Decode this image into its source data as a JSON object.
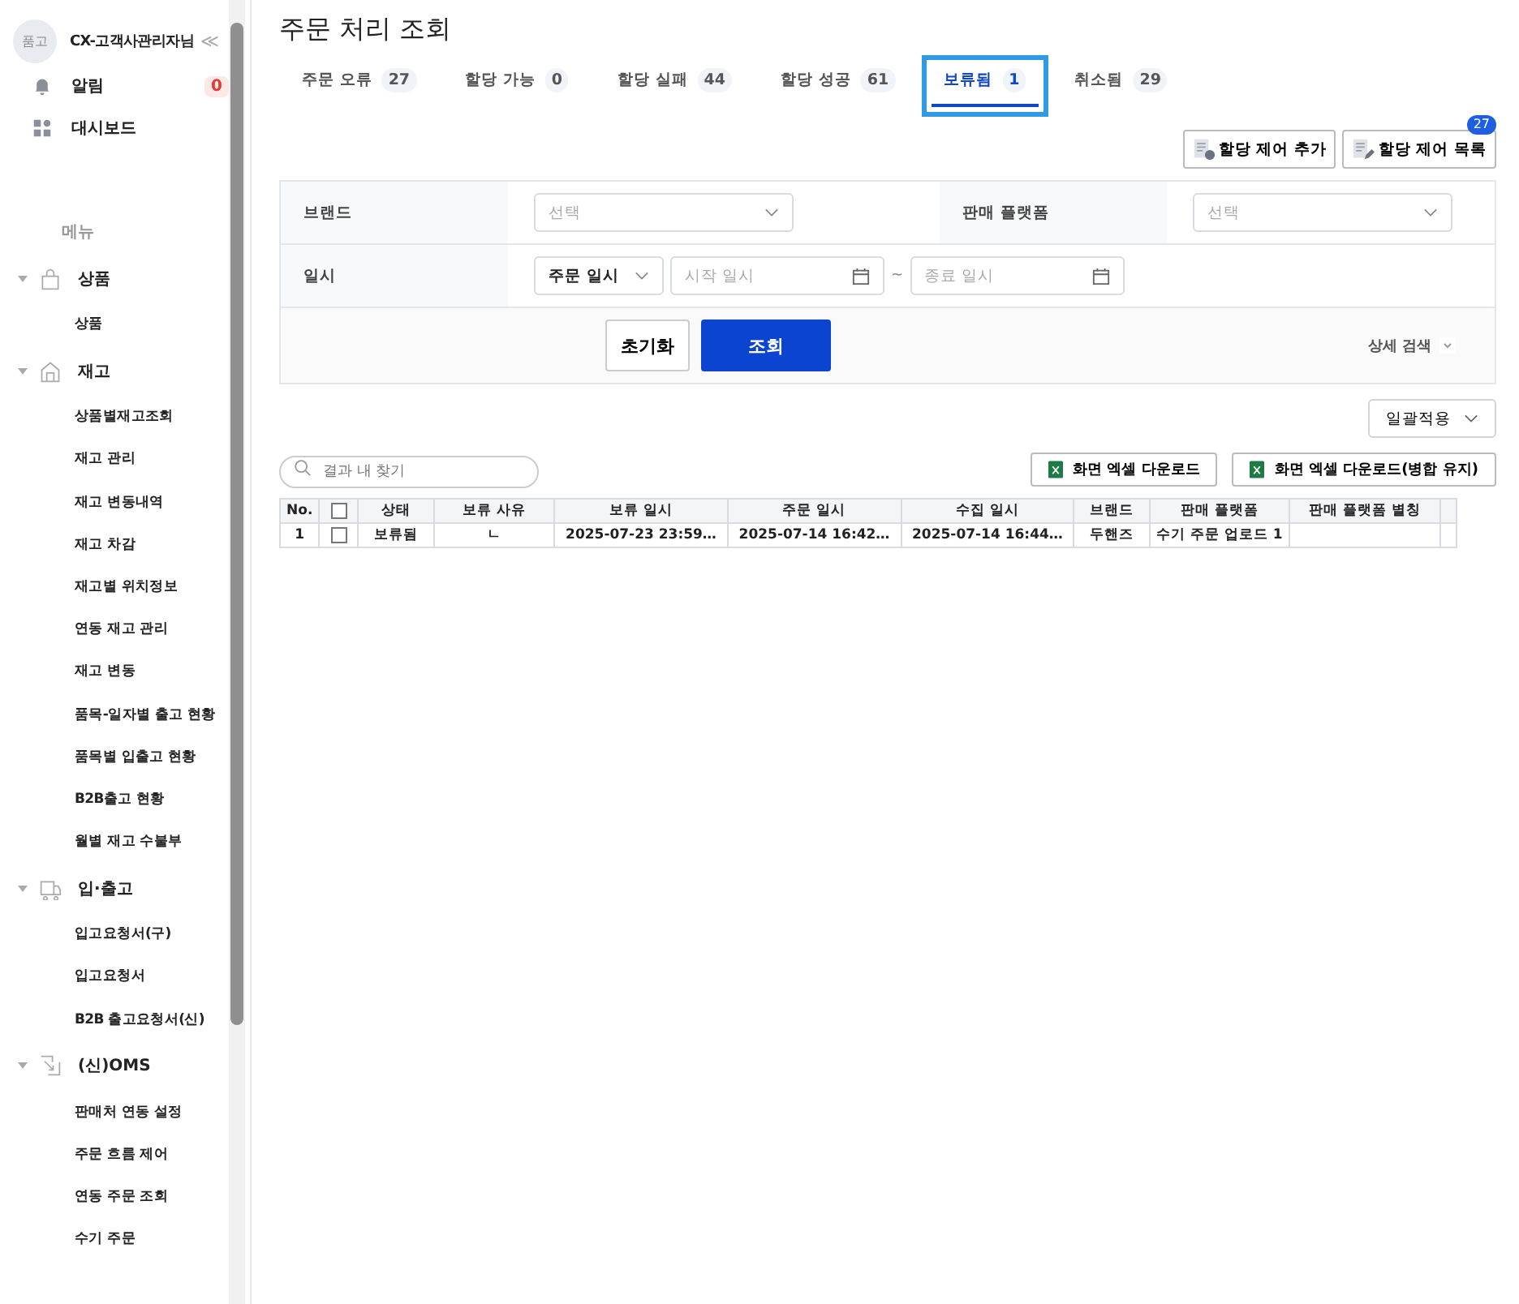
{
  "sidebar": {
    "avatar": "품고",
    "user": "CX-고객사관리자님",
    "collapse": "≪",
    "quick": [
      {
        "kind": "bell",
        "label": "알림",
        "badge": "0"
      },
      {
        "kind": "grid",
        "label": "대시보드"
      }
    ],
    "menu_label": "메뉴",
    "groups": [
      {
        "kind": "bag",
        "label": "상품",
        "expanded": true,
        "children": [
          {
            "label": "상품"
          }
        ]
      },
      {
        "kind": "house",
        "label": "재고",
        "expanded": true,
        "children": [
          {
            "label": "상품별재고조회"
          },
          {
            "label": "재고 관리"
          },
          {
            "label": "재고 변동내역"
          },
          {
            "label": "재고 차감"
          },
          {
            "label": "재고별 위치정보"
          },
          {
            "label": "연동 재고 관리"
          },
          {
            "label": "재고 변동"
          },
          {
            "label": "품목-일자별 출고 현황"
          },
          {
            "label": "품목별 입출고 현황"
          },
          {
            "label": "B2B출고 현황"
          },
          {
            "label": "월별 재고 수불부"
          }
        ]
      },
      {
        "kind": "truck",
        "label": "입·출고",
        "expanded": true,
        "children": [
          {
            "label": "입고요청서(구)"
          },
          {
            "label": "입고요청서"
          },
          {
            "label": "B2B 출고요청서(신)"
          }
        ]
      },
      {
        "kind": "swap",
        "label": "(신)OMS",
        "expanded": true,
        "children": [
          {
            "label": "판매처 연동 설정"
          },
          {
            "label": "주문 흐름 제어"
          },
          {
            "label": "연동 주문 조회"
          },
          {
            "label": "수기 주문"
          }
        ]
      }
    ]
  },
  "page": {
    "title": "주문 처리 조회",
    "tabs": [
      {
        "label": "주문 오류",
        "count": "27",
        "selected": false,
        "highlighted": false
      },
      {
        "label": "할당 가능",
        "count": "0",
        "selected": false,
        "highlighted": false
      },
      {
        "label": "할당 실패",
        "count": "44",
        "selected": false,
        "highlighted": false
      },
      {
        "label": "할당 성공",
        "count": "61",
        "selected": false,
        "highlighted": false
      },
      {
        "label": "보류됨",
        "count": "1",
        "selected": true,
        "highlighted": true
      },
      {
        "label": "취소됨",
        "count": "29",
        "selected": false,
        "highlighted": false
      }
    ],
    "actions": [
      {
        "kind": "add",
        "label": "할당 제어 추가"
      },
      {
        "kind": "list",
        "label": "할당 제어 목록",
        "badge": "27"
      }
    ]
  },
  "filters": {
    "brand": {
      "label": "브랜드",
      "placeholder": "선택"
    },
    "platform": {
      "label": "판매 플랫폼",
      "placeholder": "선택"
    },
    "date": {
      "label": "일시",
      "type_value": "주문 일시",
      "start_placeholder": "시작 일시",
      "separator": "~",
      "end_placeholder": "종료 일시"
    },
    "reset": "초기화",
    "search": "조회",
    "advanced": "상세 검색"
  },
  "bulk": "일괄적용",
  "result_search": {
    "placeholder": "결과 내 찾기"
  },
  "downloads": [
    "화면 엑셀 다운로드",
    "화면 엑셀 다운로드(병합 유지)"
  ],
  "table": {
    "columns": [
      {
        "kind": "text",
        "label": "No."
      },
      {
        "kind": "check",
        "checked": false
      },
      {
        "kind": "text",
        "label": "상태"
      },
      {
        "kind": "text",
        "label": "보류 사유"
      },
      {
        "kind": "text",
        "label": "보류 일시"
      },
      {
        "kind": "text",
        "label": "주문 일시"
      },
      {
        "kind": "text",
        "label": "수집 일시"
      },
      {
        "kind": "text",
        "label": "브랜드"
      },
      {
        "kind": "text",
        "label": "판매 플랫폼"
      },
      {
        "kind": "text",
        "label": "판매 플랫폼 별칭"
      },
      {
        "kind": "blank"
      }
    ],
    "rows": [
      {
        "checked": false,
        "cells": [
          "1",
          null,
          "보류됨",
          "ㄴ",
          "2025-07-23 23:59…",
          "2025-07-14 16:42…",
          "2025-07-14 16:44…",
          "두핸즈",
          "수기 주문 업로드 1",
          null,
          null
        ]
      }
    ]
  }
}
